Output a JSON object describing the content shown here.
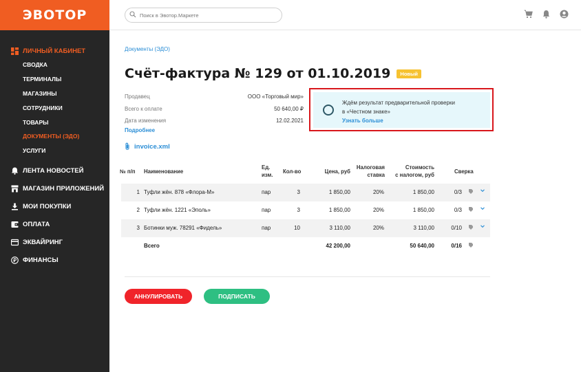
{
  "logo": "ЭВОТОР",
  "sidebar": {
    "main_section": "ЛИЧНЫЙ КАБИНЕТ",
    "sub_items": [
      {
        "label": "СВОДКА"
      },
      {
        "label": "ТЕРМИНАЛЫ"
      },
      {
        "label": "МАГАЗИНЫ"
      },
      {
        "label": "СОТРУДНИКИ"
      },
      {
        "label": "ТОВАРЫ"
      },
      {
        "label": "ДОКУМЕНТЫ (ЭДО)"
      },
      {
        "label": "УСЛУГИ"
      }
    ],
    "sections": [
      {
        "label": "ЛЕНТА НОВОСТЕЙ",
        "icon": "bell-icon"
      },
      {
        "label": "МАГАЗИН ПРИЛОЖЕНИЙ",
        "icon": "store-icon"
      },
      {
        "label": "МОИ ПОКУПКИ",
        "icon": "download-icon"
      },
      {
        "label": "ОПЛАТА",
        "icon": "wallet-icon"
      },
      {
        "label": "ЭКВАЙРИНГ",
        "icon": "card-icon"
      },
      {
        "label": "ФИНАНСЫ",
        "icon": "ruble-icon"
      }
    ],
    "accent_color": "#f05d22"
  },
  "header": {
    "search_placeholder": "Поиск в Эвотор.Маркете"
  },
  "breadcrumb": "Документы (ЭДО)",
  "page": {
    "title": "Счёт-фактура № 129 от 01.10.2019",
    "status_badge": "Новый"
  },
  "info": {
    "rows": [
      {
        "label": "Продавец",
        "value": "ООО «Торговый мир»"
      },
      {
        "label": "Всего к оплате",
        "value": "50 640,00 ₽"
      },
      {
        "label": "Дата изменения",
        "value": "12.02.2021"
      }
    ],
    "more_link": "Подробнее"
  },
  "notice": {
    "line1": "Ждём результат предварительной проверки",
    "line2": "в «Честном знаке»",
    "link": "Узнать больше"
  },
  "attachment": "invoice.xml",
  "table": {
    "headers": {
      "no": "№ п/п",
      "name": "Наименование",
      "unit_1": "Ед.",
      "unit_2": "изм.",
      "qty": "Кол-во",
      "price": "Цена, руб",
      "tax_1": "Налоговая",
      "tax_2": "ставка",
      "total_1": "Стоимость",
      "total_2": "с налогом, руб",
      "check": "Сверка"
    },
    "rows": [
      {
        "no": "1",
        "name": "Туфли жён. 878 «Флора-М»",
        "unit": "пар",
        "qty": "3",
        "price": "1 850,00",
        "tax": "20%",
        "total": "1 850,00",
        "check": "0/3"
      },
      {
        "no": "2",
        "name": "Туфли жён. 1221 «Эполь»",
        "unit": "пар",
        "qty": "3",
        "price": "1 850,00",
        "tax": "20%",
        "total": "1 850,00",
        "check": "0/3"
      },
      {
        "no": "3",
        "name": "Ботинки муж. 78291 «Фидель»",
        "unit": "пар",
        "qty": "10",
        "price": "3 110,00",
        "tax": "20%",
        "total": "3 110,00",
        "check": "0/10"
      }
    ],
    "total_row": {
      "label": "Всего",
      "price": "42 200,00",
      "total": "50 640,00",
      "check": "0/16"
    }
  },
  "actions": {
    "cancel": "АННУЛИРОВАТЬ",
    "sign": "ПОДПИСАТЬ"
  }
}
